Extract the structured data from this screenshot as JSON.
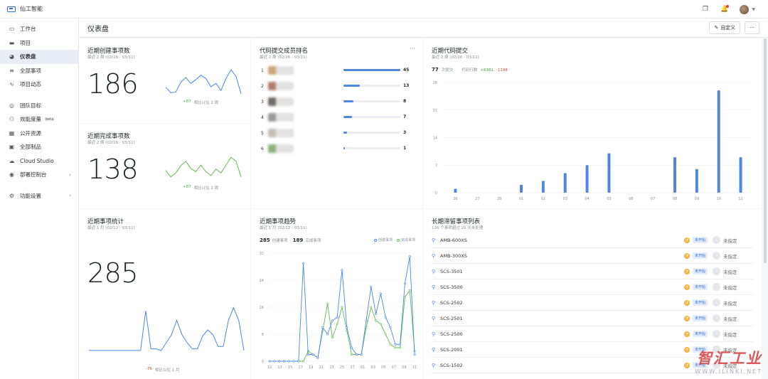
{
  "app": {
    "name": "仙工智能"
  },
  "sidebar": {
    "items": [
      {
        "label": "工作台",
        "icon": "monitor-icon"
      },
      {
        "label": "项目",
        "icon": "folder-icon"
      },
      {
        "label": "仪表盘",
        "icon": "dashboard-icon",
        "active": true
      },
      {
        "label": "全部事项",
        "icon": "filter-icon"
      },
      {
        "label": "项目动态",
        "icon": "activity-icon"
      },
      {
        "label": "团队目标",
        "icon": "target-icon"
      },
      {
        "label": "效能度量",
        "icon": "people-icon",
        "badge": "beta"
      },
      {
        "label": "公开资源",
        "icon": "grid-icon"
      },
      {
        "label": "全部制品",
        "icon": "box-icon"
      },
      {
        "label": "Cloud Studio",
        "icon": "cloud-icon"
      },
      {
        "label": "部署控制台",
        "icon": "deploy-icon",
        "chevron": true
      },
      {
        "label": "功能设置",
        "icon": "settings-icon",
        "chevron": true
      }
    ]
  },
  "header": {
    "title": "仪表盘",
    "customize_label": "自定义",
    "more_label": "···"
  },
  "cards": {
    "created": {
      "title": "近期创建事项数",
      "subtitle": "最近 2 周 (02/26 - 03/11)",
      "value": "186",
      "delta": "+87",
      "compare": "相比以往 2 周",
      "line": [
        40,
        30,
        31,
        49,
        58,
        47,
        54,
        62,
        56,
        41,
        47,
        34,
        56,
        72,
        60,
        28
      ]
    },
    "completed": {
      "title": "近期完成事项数",
      "subtitle": "最近 2 周 (02/26 - 03/11)",
      "value": "138",
      "delta": "+87",
      "compare": "相比以往 2 周",
      "line": [
        40,
        30,
        36,
        47,
        54,
        43,
        38,
        48,
        38,
        32,
        42,
        36,
        48,
        60,
        54,
        30
      ]
    },
    "ranking": {
      "title": "代码提交成员排名",
      "subtitle": "最近 2 周 (02/26 - 03/11)",
      "more": "···",
      "rows": [
        {
          "rank": "1",
          "value": 45
        },
        {
          "rank": "2",
          "value": 13
        },
        {
          "rank": "3",
          "value": 8
        },
        {
          "rank": "4",
          "value": 7
        },
        {
          "rank": "5",
          "value": 3
        },
        {
          "rank": "6",
          "value": 1
        }
      ]
    },
    "commits": {
      "title": "近期代码提交",
      "subtitle": "最近 2 周 (02/26 - 03/11)",
      "total": "77",
      "total_label": "次提交",
      "lines_label": "代码行数",
      "added": "+6381",
      "removed": "-1198"
    },
    "stats": {
      "title": "近期事项统计",
      "subtitle": "最近 1 月 (02/12 - 03/11)",
      "value": "285",
      "delta": "-76",
      "compare": "相比以往 1 月",
      "line": [
        10,
        10,
        10,
        10,
        10,
        10,
        10,
        10,
        10,
        10,
        10,
        60,
        12,
        12,
        10,
        20,
        30,
        48,
        30,
        20,
        12,
        12,
        28,
        36,
        30,
        15,
        15,
        48,
        64,
        48,
        10
      ]
    },
    "trend": {
      "title": "近期事项趋势",
      "subtitle": "最近 1 月 (02/12 - 03/11)",
      "created_total": "285",
      "created_label": "创建事项",
      "done_total": "189",
      "done_label": "完成事项"
    },
    "stale": {
      "title": "长期滞留事项列表",
      "subtitle": "126 个事项超过 20 天未处理",
      "status_label": "未开始",
      "assignee_label": "未指定",
      "rows": [
        {
          "name": "AMB-600XS"
        },
        {
          "name": "AMB-300XS"
        },
        {
          "name": "SCS-3501"
        },
        {
          "name": "SCS-3500"
        },
        {
          "name": "SCS-2502"
        },
        {
          "name": "SCS-2501"
        },
        {
          "name": "SCS-2500"
        },
        {
          "name": "SCS-2001"
        },
        {
          "name": "SCS-1502"
        }
      ]
    }
  },
  "watermark": {
    "title": "智汇工业",
    "url": "WWW.ILINKI.NET"
  },
  "chart_data": [
    {
      "type": "bar",
      "title": "近期代码提交",
      "categories": [
        "26",
        "27",
        "28",
        "01",
        "02",
        "03",
        "04",
        "05",
        "06",
        "07",
        "08",
        "09",
        "10",
        "11"
      ],
      "values": [
        1,
        0,
        0,
        2,
        3,
        5,
        7,
        10,
        0,
        0,
        9,
        6,
        26,
        9
      ],
      "ylim": [
        0,
        28
      ],
      "yticks": [
        "0",
        "7",
        "14",
        "21",
        "28"
      ],
      "grid": true
    },
    {
      "type": "line",
      "title": "近期事项趋势",
      "categories": [
        "12",
        "13",
        "15",
        "17",
        "19",
        "21",
        "23",
        "25",
        "27",
        "01",
        "03",
        "05",
        "07",
        "09",
        "11"
      ],
      "ylim": [
        0,
        32
      ],
      "yticks": [
        "0",
        "8",
        "16",
        "24",
        "32"
      ],
      "legend": "top-right",
      "series": [
        {
          "name": "创建事项",
          "color": "#4f86e0",
          "values": [
            0,
            0,
            0,
            0,
            0,
            0,
            0,
            29,
            2,
            2,
            1,
            10,
            8,
            12,
            13,
            27,
            10,
            4,
            2,
            2,
            12,
            22,
            14,
            20,
            13,
            10,
            5,
            5,
            23,
            31,
            2
          ]
        },
        {
          "name": "完成事项",
          "color": "#66bb55",
          "values": [
            0,
            0,
            0,
            0,
            0,
            0,
            0,
            0,
            3,
            2,
            1,
            9,
            17,
            7,
            11,
            16,
            9,
            2,
            2,
            2,
            10,
            16,
            12,
            11,
            8,
            5,
            4,
            4,
            19,
            21,
            3
          ]
        }
      ]
    }
  ]
}
